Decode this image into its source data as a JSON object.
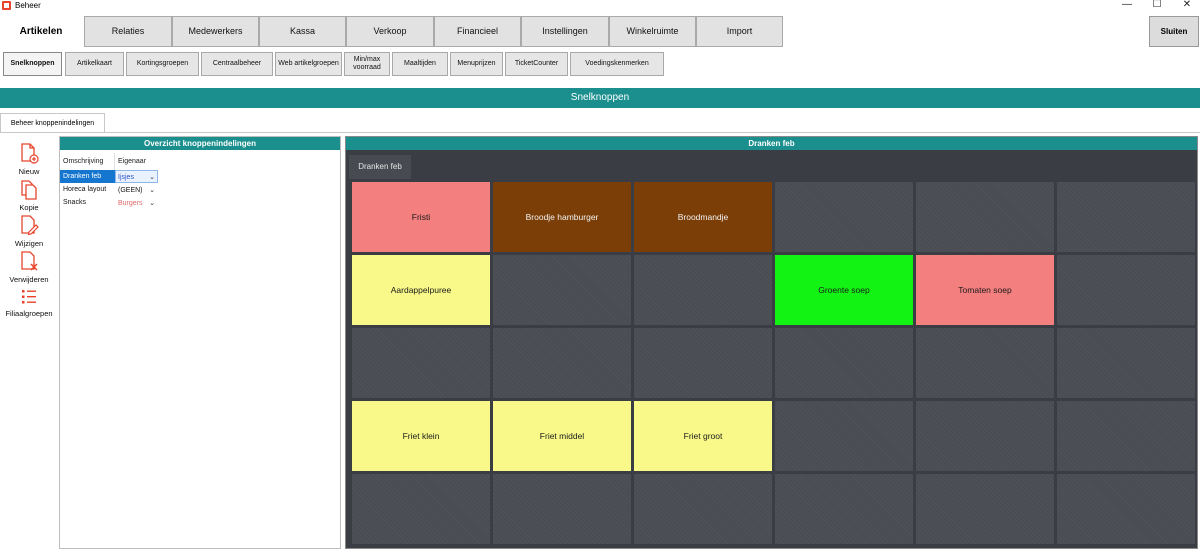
{
  "window": {
    "title": "Beheer",
    "minimize": "—",
    "maximize": "☐",
    "close": "✕"
  },
  "main_nav": {
    "current": "Artikelen",
    "tabs": [
      "Relaties",
      "Medewerkers",
      "Kassa",
      "Verkoop",
      "Financieel",
      "Instellingen",
      "Winkelruimte",
      "Import"
    ],
    "close_label": "Sluiten"
  },
  "sub_nav": {
    "tabs": [
      "Snelknoppen",
      "Artikelkaart",
      "Kortingsgroepen",
      "Centraalbeheer",
      "Web artikelgroepen",
      "Min/max voorraad",
      "Maaltijden",
      "Menuprijzen",
      "TicketCounter",
      "Voedingskenmerken"
    ],
    "active_index": 0
  },
  "page_header": "Snelknoppen",
  "section_tab": "Beheer knoppenindelingen",
  "toolbar": {
    "new": "Nieuw",
    "copy": "Kopie",
    "edit": "Wijzigen",
    "delete": "Verwijderen",
    "branch_groups": "Filiaalgroepen"
  },
  "overview": {
    "title": "Overzicht knoppenindelingen",
    "columns": [
      "Omschrijving",
      "Eigenaar"
    ],
    "rows": [
      {
        "omschrijving": "Dranken feb",
        "eigenaar": "Ijsjes",
        "selected": true,
        "owner_color": "#2a56c6"
      },
      {
        "omschrijving": "Horeca layout",
        "eigenaar": "(GEEN)",
        "selected": false,
        "owner_color": "#111111"
      },
      {
        "omschrijving": "Snacks",
        "eigenaar": "Burgers",
        "selected": false,
        "owner_color": "#e36b6b"
      }
    ]
  },
  "grid": {
    "title": "Dranken feb",
    "tab": "Dranken feb",
    "columns": 6,
    "rows": 5,
    "buttons": [
      {
        "row": 0,
        "col": 0,
        "label": "Fristi",
        "color": "#f47f7f"
      },
      {
        "row": 0,
        "col": 1,
        "label": "Broodje hamburger",
        "color": "#7a3e06"
      },
      {
        "row": 0,
        "col": 2,
        "label": "Broodmandje",
        "color": "#7a3e06"
      },
      {
        "row": 1,
        "col": 0,
        "label": "Aardappelpuree",
        "color": "#f9f98a"
      },
      {
        "row": 1,
        "col": 3,
        "label": "Groente soep",
        "color": "#13f313"
      },
      {
        "row": 1,
        "col": 4,
        "label": "Tomaten soep",
        "color": "#f47f7f"
      },
      {
        "row": 3,
        "col": 0,
        "label": "Friet klein",
        "color": "#f9f98a"
      },
      {
        "row": 3,
        "col": 1,
        "label": "Friet middel",
        "color": "#f9f98a"
      },
      {
        "row": 3,
        "col": 2,
        "label": "Friet groot",
        "color": "#f9f98a"
      }
    ]
  },
  "colors": {
    "accent": "#1b8e8e",
    "icon": "#e8442b",
    "empty_cell": "#4a4c53"
  }
}
